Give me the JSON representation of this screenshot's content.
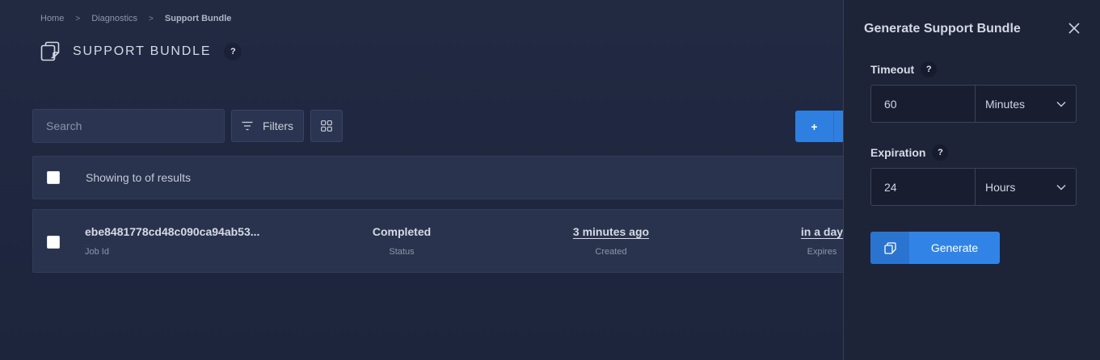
{
  "breadcrumb": {
    "items": [
      "Home",
      "Diagnostics",
      "Support Bundle"
    ],
    "separator": ">"
  },
  "page": {
    "title": "SUPPORT BUNDLE",
    "help": "?"
  },
  "toolbar": {
    "search_placeholder": "Search",
    "filters_label": "Filters",
    "add_label": "+"
  },
  "table": {
    "results_text": "Showing to of results",
    "rows": [
      {
        "job_id": "ebe8481778cd48c090ca94ab53...",
        "job_id_label": "Job Id",
        "status": "Completed",
        "status_label": "Status",
        "created": "3 minutes ago",
        "created_label": "Created",
        "expires": "in a day",
        "expires_label": "Expires"
      }
    ]
  },
  "panel": {
    "title": "Generate Support Bundle",
    "timeout": {
      "label": "Timeout",
      "help": "?",
      "value": "60",
      "unit": "Minutes"
    },
    "expiration": {
      "label": "Expiration",
      "help": "?",
      "value": "24",
      "unit": "Hours"
    },
    "generate_label": "Generate"
  },
  "colors": {
    "accent": "#3184e6",
    "background": "#20283f",
    "panel": "#1d2438",
    "card": "#2a334d"
  },
  "icons": {
    "title": "support-bundle-icon",
    "filters": "filter-lines-icon",
    "grid": "grid-icon",
    "close": "close-icon",
    "chevron": "chevron-down-icon",
    "generate": "bundle-icon"
  }
}
